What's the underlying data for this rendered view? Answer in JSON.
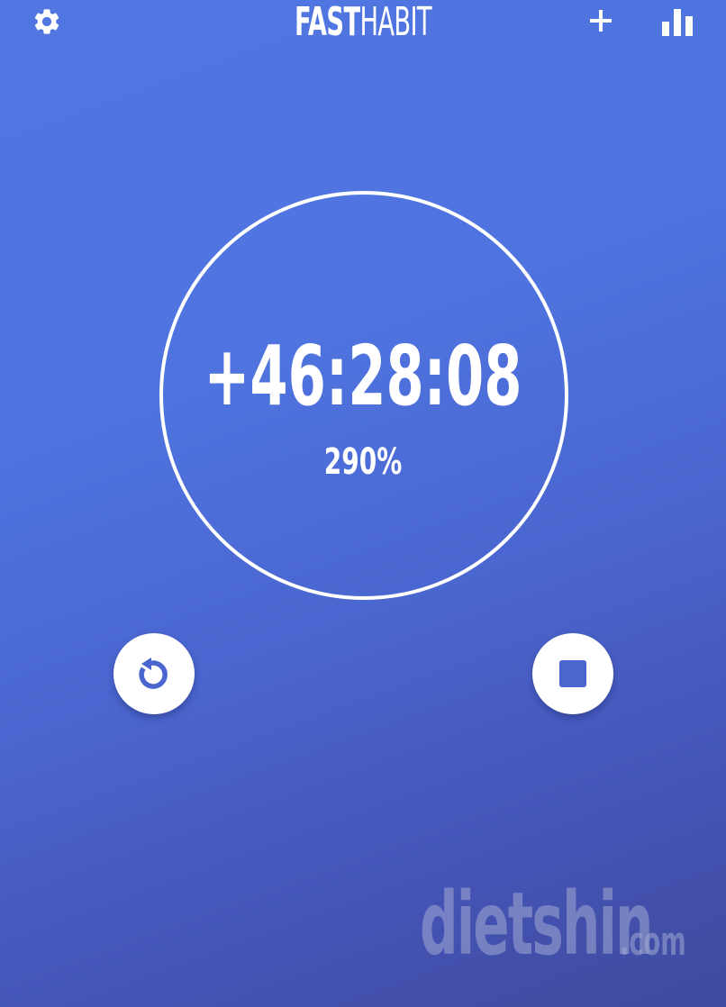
{
  "app": {
    "title_bold": "FAST",
    "title_light": "HABIT"
  },
  "toolbar": {
    "settings_icon": "gear-icon",
    "add_icon": "plus-icon",
    "stats_icon": "bar-chart-icon"
  },
  "timer": {
    "elapsed": "+46:28:08",
    "percent": "290%"
  },
  "controls": {
    "reset_icon": "reset-icon",
    "stop_icon": "stop-icon"
  },
  "watermark": {
    "main": "dietshin",
    "suffix": ".com"
  },
  "colors": {
    "background_top": "#5176e2",
    "background_bottom": "#3f4b9e",
    "foreground": "#ffffff",
    "icon_blue": "#4a67cf"
  }
}
